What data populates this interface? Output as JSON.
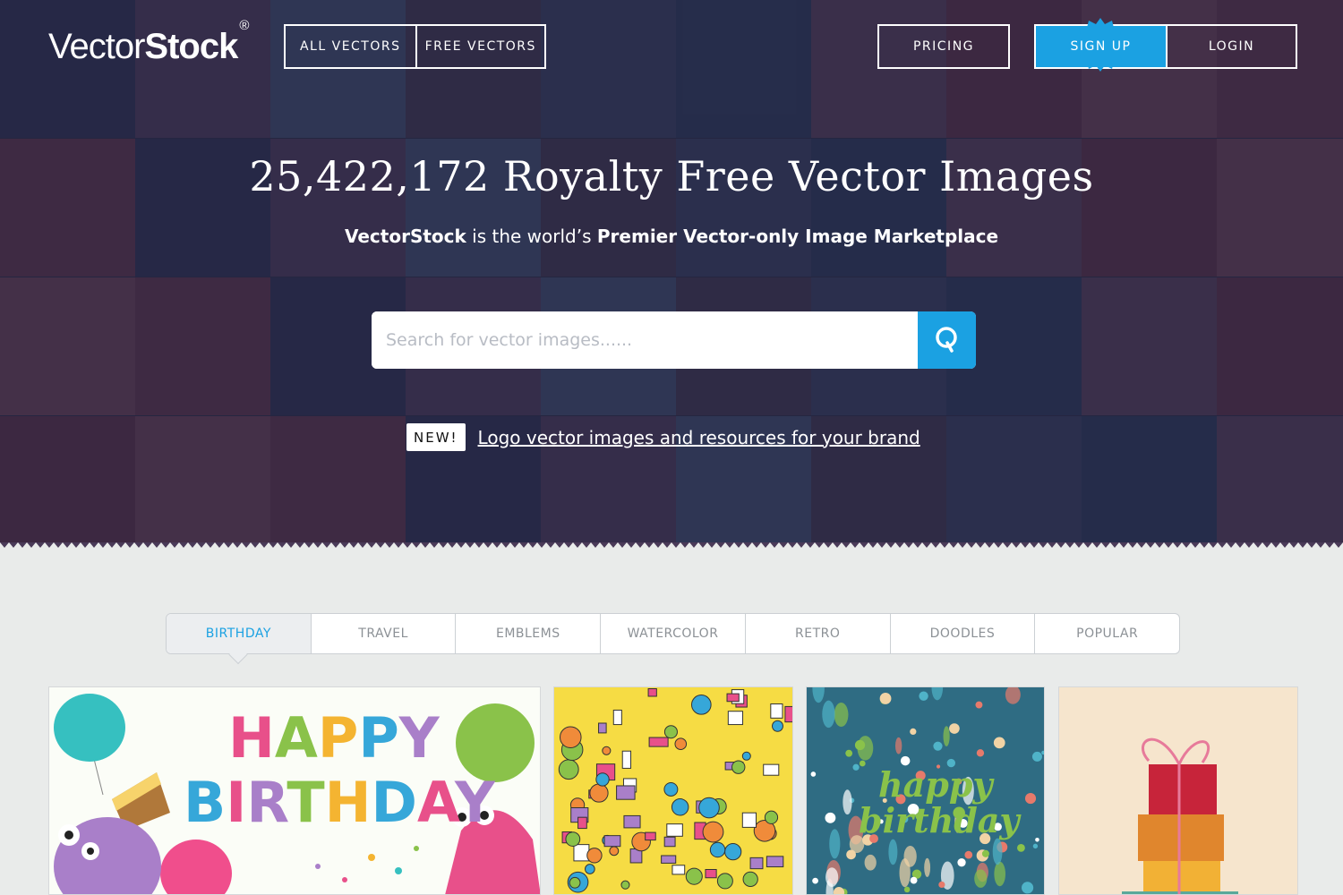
{
  "header": {
    "logo_light": "Vector",
    "logo_bold": "Stock",
    "logo_mark": "®",
    "nav": {
      "all_vectors": "ALL VECTORS",
      "free_vectors": "FREE VECTORS",
      "pricing": "PRICING",
      "sign_up": "SIGN UP",
      "login": "LOGIN"
    }
  },
  "hero": {
    "headline": "25,422,172 Royalty Free Vector Images",
    "subline_brand": "VectorStock",
    "subline_middle": " is the world’s ",
    "subline_bold": "Premier Vector-only Image Marketplace",
    "search": {
      "placeholder": "Search for vector images......",
      "value": ""
    },
    "promo": {
      "badge": "NEW!",
      "link": "Logo vector images and resources for your brand"
    }
  },
  "tabs": [
    {
      "label": "BIRTHDAY",
      "active": true
    },
    {
      "label": "TRAVEL",
      "active": false
    },
    {
      "label": "EMBLEMS",
      "active": false
    },
    {
      "label": "WATERCOLOR",
      "active": false
    },
    {
      "label": "RETRO",
      "active": false
    },
    {
      "label": "DOODLES",
      "active": false
    },
    {
      "label": "POPULAR",
      "active": false
    }
  ],
  "thumbnails": [
    {
      "name": "happy-birthday-monsters",
      "title_line1": "HAPPY",
      "title_line2": "BIRTHDAY"
    },
    {
      "name": "birthday-doodle-pattern"
    },
    {
      "name": "floral-happy-birthday",
      "title_line1": "happy",
      "title_line2": "birthday"
    },
    {
      "name": "gift-boxes-stack"
    }
  ],
  "colors": {
    "accent": "#1ba1e2",
    "page_bg": "#e9ebea",
    "hero_bg": "#2a2c4a"
  },
  "icons": {
    "search": "search-icon",
    "signup_badge": "starburst-badge-icon"
  }
}
